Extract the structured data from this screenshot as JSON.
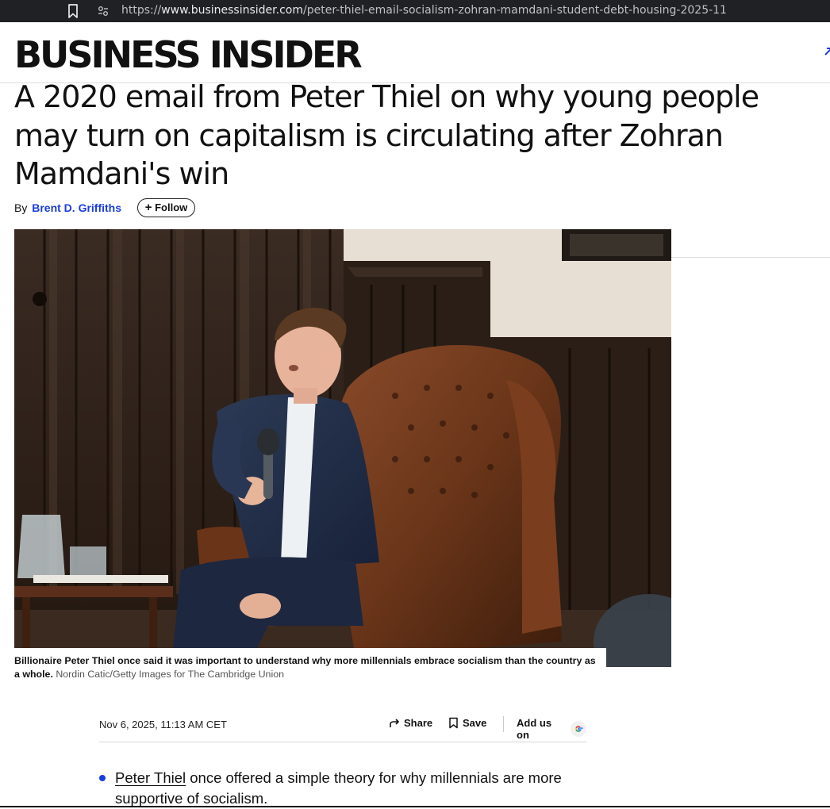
{
  "browser": {
    "url_scheme": "https://",
    "url_host": "www.businessinsider.com",
    "url_path": "/peter-thiel-email-socialism-zohran-mamdani-student-debt-housing-2025-11"
  },
  "site": {
    "logo_text": "BUSINESS INSIDER"
  },
  "article": {
    "headline": "A 2020 email from Peter Thiel on why young people may turn on capitalism is circulating after Zohran Mamdani's win",
    "byline_prefix": "By",
    "author": "Brent D. Griffiths",
    "follow_label": "Follow",
    "caption": "Billionaire Peter Thiel once said it was important to understand why more millennials embrace socialism than the country as a whole.",
    "credit": "Nordin Catic/Getty Images for The Cambridge Union",
    "date": "Nov 6, 2025, 11:13 AM CET",
    "share_label": "Share",
    "save_label": "Save",
    "add_us_label": "Add us on",
    "key_point_link": "Peter Thiel",
    "key_point_text": " once offered a simple theory for why millennials are more supportive of socialism."
  },
  "colors": {
    "accent": "#1a3de0",
    "text": "#111111",
    "chrome": "#202124"
  },
  "icons": [
    "bookmark-icon",
    "site-settings-icon",
    "plus-icon",
    "share-arrow-icon",
    "bookmark-save-icon",
    "google-icon"
  ]
}
